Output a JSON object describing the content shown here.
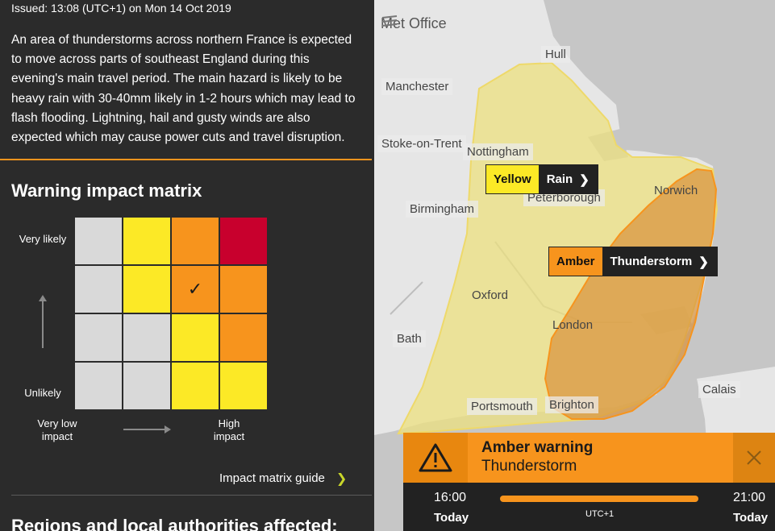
{
  "left_panel": {
    "issued": "Issued: 13:08 (UTC+1) on Mon 14 Oct 2019",
    "summary": "An area of thunderstorms across northern France is expected to move across parts of southeast England during this evening's main travel period. The main hazard is likely to be heavy rain with 30-40mm likely in 1-2 hours which may lead to flash flooding. Lightning, hail and gusty winds are also expected which may cause power cuts and travel disruption.",
    "matrix_heading": "Warning impact matrix",
    "matrix": {
      "likelihood_top": "Very likely",
      "likelihood_bottom": "Unlikely",
      "impact_left": "Very low impact",
      "impact_right": "High impact",
      "colors": {
        "grey": "#d9d9d9",
        "yellow": "#fce926",
        "amber": "#f7941d",
        "red": "#c8002d"
      },
      "rows": [
        [
          "grey",
          "yellow",
          "amber",
          "red"
        ],
        [
          "grey",
          "yellow",
          "amber",
          "amber"
        ],
        [
          "grey",
          "grey",
          "yellow",
          "amber"
        ],
        [
          "grey",
          "grey",
          "yellow",
          "yellow"
        ]
      ],
      "selected_row": 1,
      "selected_col": 2,
      "tick_glyph": "✓"
    },
    "guide_link": "Impact matrix guide",
    "regions_heading": "Regions and local authorities affected:"
  },
  "map": {
    "brand": "Met Office",
    "cities": {
      "hull": "Hull",
      "manchester": "Manchester",
      "stoke": "Stoke-on-Trent",
      "nottingham": "Nottingham",
      "birmingham": "Birmingham",
      "peterborough": "Peterborough",
      "norwich": "Norwich",
      "oxford": "Oxford",
      "london": "London",
      "bath": "Bath",
      "portsmouth": "Portsmouth",
      "brighton": "Brighton",
      "calais": "Calais"
    },
    "yellow_label": {
      "level": "Yellow",
      "type": "Rain"
    },
    "amber_label": {
      "level": "Amber",
      "type": "Thunderstorm"
    }
  },
  "card": {
    "title": "Amber warning",
    "subtitle": "Thunderstorm",
    "start_time": "16:00",
    "start_day": "Today",
    "end_time": "21:00",
    "end_day": "Today",
    "timezone": "UTC+1",
    "accent": "#f7941d"
  }
}
